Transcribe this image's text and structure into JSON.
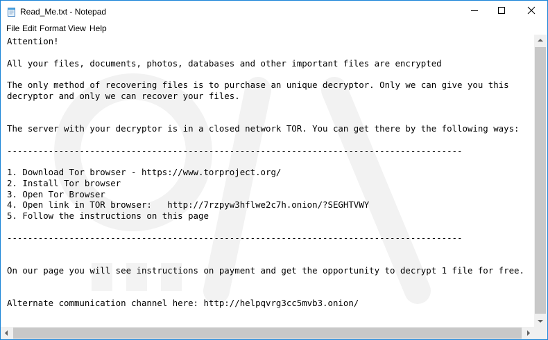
{
  "window": {
    "title": "Read_Me.txt - Notepad",
    "accent_color": "#1883d7"
  },
  "menu": {
    "file": "File",
    "edit": "Edit",
    "format": "Format",
    "view": "View",
    "help": "Help"
  },
  "document": {
    "text": "Attention!\n\nAll your files, documents, photos, databases and other important files are encrypted\n\nThe only method of recovering files is to purchase an unique decryptor. Only we can give you this\ndecryptor and only we can recover your files.\n\n\nThe server with your decryptor is in a closed network TOR. You can get there by the following ways:\n\n----------------------------------------------------------------------------------------\n\n1. Download Tor browser - https://www.torproject.org/\n2. Install Tor browser\n3. Open Tor Browser\n4. Open link in TOR browser:   http://7rzpyw3hflwe2c7h.onion/?SEGHTVWY\n5. Follow the instructions on this page\n\n----------------------------------------------------------------------------------------\n\n\nOn our page you will see instructions on payment and get the opportunity to decrypt 1 file for free.\n\n\nAlternate communication channel here: http://helpqvrg3cc5mvb3.onion/"
  },
  "icons": {
    "app": "notepad-icon",
    "minimize": "minimize-icon",
    "maximize": "maximize-icon",
    "close": "close-icon"
  }
}
